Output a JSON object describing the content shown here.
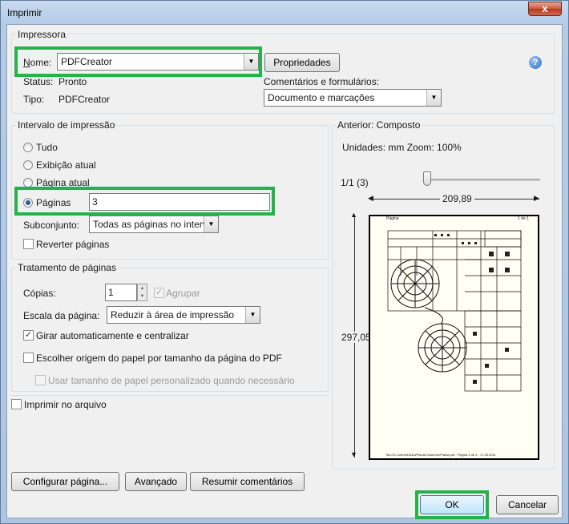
{
  "window": {
    "title": "Imprimir",
    "close_glyph": "x"
  },
  "printer": {
    "group_title": "Impressora",
    "name_label": "Nome:",
    "name_value": "PDFCreator",
    "properties_button": "Propriedades",
    "status_label": "Status:",
    "status_value": "Pronto",
    "type_label": "Tipo:",
    "type_value": "PDFCreator",
    "comments_label": "Comentários e formulários:",
    "comments_value": "Documento e marcações",
    "help_icon": "question-icon"
  },
  "print_range": {
    "group_title": "Intervalo de impressão",
    "options": [
      "Tudo",
      "Exibição atual",
      "Página atual",
      "Páginas"
    ],
    "selected": "Páginas",
    "pages_value": "3",
    "subset_label": "Subconjunto:",
    "subset_value": "Todas as páginas no interv",
    "reverse_label": "Reverter páginas"
  },
  "page_handling": {
    "group_title": "Tratamento de páginas",
    "copies_label": "Cópias:",
    "copies_value": "1",
    "collate_label": "Agrupar",
    "scale_label": "Escala da página:",
    "scale_value": "Reduzir à área de impressão",
    "autorotate_label": "Girar automaticamente e centralizar",
    "autorotate_checked": true,
    "paper_source_label": "Escolher origem do papel por tamanho da página do PDF",
    "custom_paper_label": "Usar tamanho de papel personalizado quando necessário"
  },
  "print_to_file_label": "Imprimir no arquivo",
  "preview": {
    "group_title": "Anterior: Composto",
    "units_text": "Unidades: mm Zoom: 100%",
    "page_counter": "1/1 (3)",
    "width_dim": "209,89",
    "height_dim": "297,05",
    "page_header_left": "Página",
    "page_header_right": "1 de 1",
    "page_footer": "file:///C:/Users/David/Planta Desenho/Planta.pdf - Página 3 de 3 - 17.05.2011"
  },
  "buttons": {
    "page_setup": "Configurar página...",
    "advanced": "Avançado",
    "summarize": "Resumir comentários",
    "ok": "OK",
    "cancel": "Cancelar"
  },
  "colors": {
    "highlight": "#27b14a",
    "radio_dot": "#2a5a9a"
  }
}
